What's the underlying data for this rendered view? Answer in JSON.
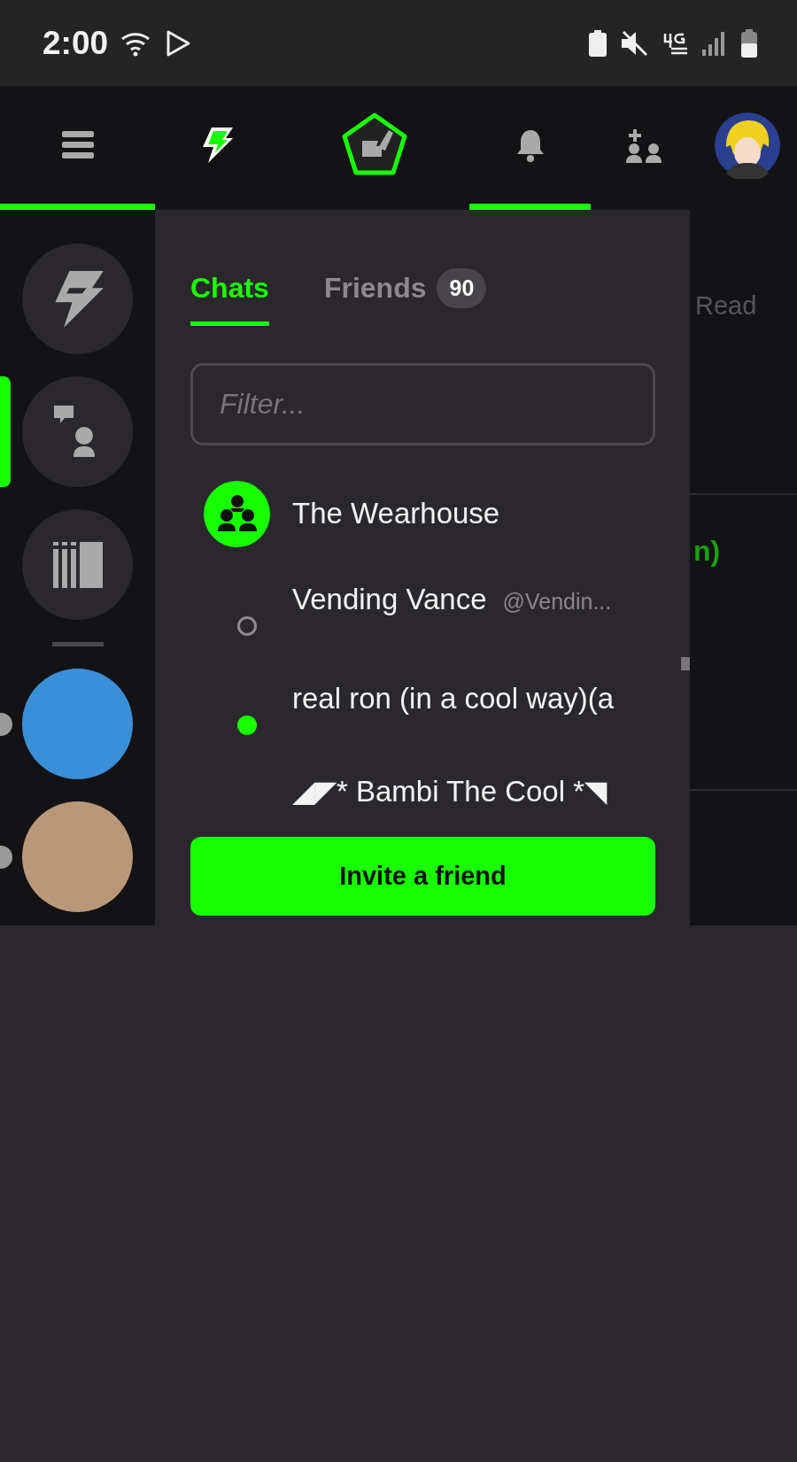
{
  "status_bar": {
    "time": "2:00"
  },
  "nav": [
    {
      "kind": "menu",
      "selected": true
    },
    {
      "kind": "bolt",
      "selected": false
    },
    {
      "kind": "logo",
      "selected": false
    },
    {
      "kind": "bell",
      "selected": true
    },
    {
      "kind": "add-friend",
      "selected": false
    },
    {
      "kind": "avatar",
      "selected": false
    }
  ],
  "rail": [
    {
      "kind": "bolt",
      "selected": false
    },
    {
      "kind": "chat-person",
      "selected": true
    },
    {
      "kind": "library",
      "selected": false
    },
    {
      "kind": "divider"
    },
    {
      "kind": "server",
      "color": "#3a8fd9",
      "selected": false
    },
    {
      "kind": "server",
      "color": "#b99879",
      "selected": false
    }
  ],
  "panel": {
    "tabs": [
      {
        "label": "Chats",
        "selected": true
      },
      {
        "label": "Friends",
        "badge": "90",
        "selected": false
      }
    ],
    "filter": {
      "placeholder": "Filter..."
    },
    "chats": [
      {
        "kind": "group",
        "name": "The Wearhouse"
      },
      {
        "kind": "user",
        "name": "Vending Vance",
        "handle": "@Vendin...",
        "online": false
      },
      {
        "kind": "user",
        "name": "real ron (in a cool way)(a",
        "online": true
      },
      {
        "kind": "plain",
        "name": "◢◤*  Bambi The Cool  *◥"
      }
    ],
    "invite_button": "Invite a friend"
  },
  "background": {
    "header_text": "Read",
    "accent_text": "n)"
  }
}
